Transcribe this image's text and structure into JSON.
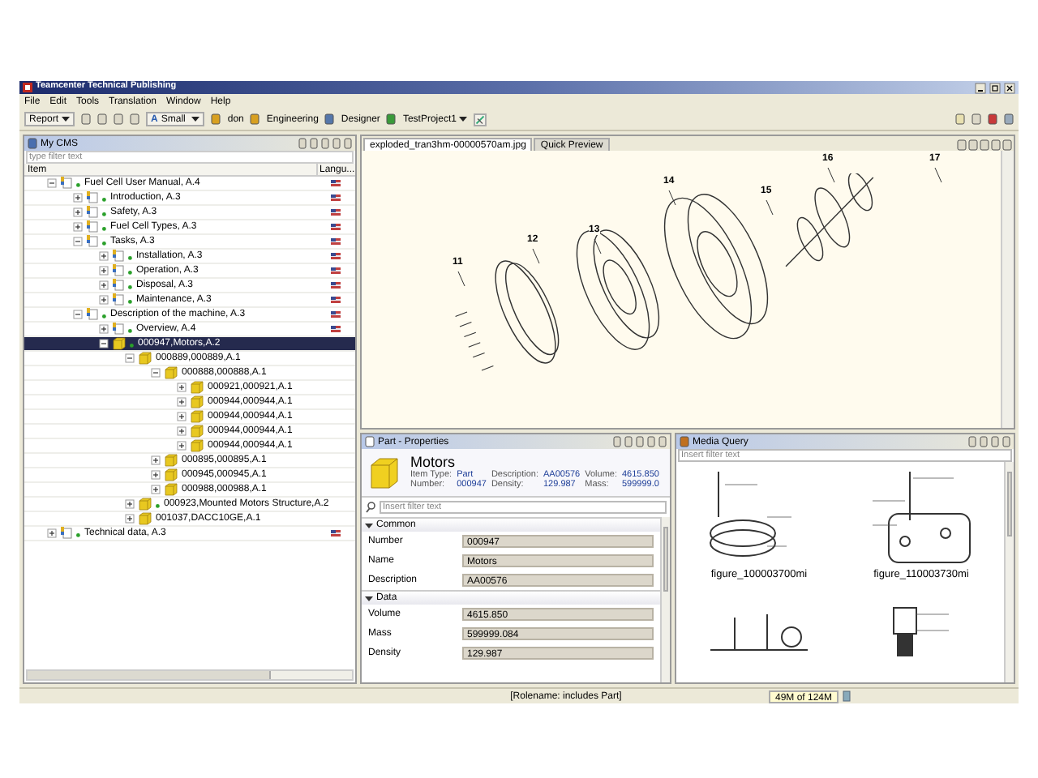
{
  "window": {
    "title": "Teamcenter Technical Publishing"
  },
  "menu": [
    "File",
    "Edit",
    "Tools",
    "Translation",
    "Window",
    "Help"
  ],
  "toolbar": {
    "report": "Report",
    "size_icon": "A",
    "size": "Small",
    "user": "don",
    "group": "Engineering",
    "role": "Designer",
    "project": "TestProject1"
  },
  "cms": {
    "tab": "My CMS",
    "filter_placeholder": "type filter text",
    "columns": [
      "Item",
      "Langu..."
    ],
    "tree": [
      {
        "label": "Fuel Cell User Manual, A.4",
        "kind": "document",
        "expanded": true,
        "selected": false,
        "released": true,
        "children": [
          {
            "label": "Introduction, A.3",
            "kind": "document",
            "expanded": false,
            "selected": false,
            "released": true
          },
          {
            "label": "Safety, A.3",
            "kind": "document",
            "expanded": false,
            "selected": false,
            "released": true
          },
          {
            "label": "Fuel Cell Types, A.3",
            "kind": "document",
            "expanded": false,
            "selected": false,
            "released": true
          },
          {
            "label": "Tasks, A.3",
            "kind": "document",
            "expanded": true,
            "selected": false,
            "released": true,
            "children": [
              {
                "label": "Installation, A.3",
                "kind": "document",
                "expanded": false,
                "selected": false,
                "released": true
              },
              {
                "label": "Operation, A.3",
                "kind": "document",
                "expanded": false,
                "selected": false,
                "released": true
              },
              {
                "label": "Disposal, A.3",
                "kind": "document",
                "expanded": false,
                "selected": false,
                "released": true
              },
              {
                "label": "Maintenance, A.3",
                "kind": "document",
                "expanded": false,
                "selected": false,
                "released": true
              }
            ]
          },
          {
            "label": "Description of the machine, A.3",
            "kind": "document",
            "expanded": true,
            "selected": false,
            "released": true,
            "children": [
              {
                "label": "Overview, A.4",
                "kind": "document",
                "expanded": false,
                "selected": false,
                "released": true
              },
              {
                "label": "000947,Motors,A.2",
                "kind": "part",
                "expanded": true,
                "selected": true,
                "released": true,
                "children": [
                  {
                    "label": "000889,000889,A.1",
                    "kind": "part",
                    "expanded": true,
                    "selected": false,
                    "released": false,
                    "children": [
                      {
                        "label": "000888,000888,A.1",
                        "kind": "part",
                        "expanded": true,
                        "selected": false,
                        "released": false,
                        "children": [
                          {
                            "label": "000921,000921,A.1",
                            "kind": "part",
                            "expanded": false,
                            "selected": false,
                            "released": false
                          },
                          {
                            "label": "000944,000944,A.1",
                            "kind": "part",
                            "expanded": false,
                            "selected": false,
                            "released": false
                          },
                          {
                            "label": "000944,000944,A.1",
                            "kind": "part",
                            "expanded": false,
                            "selected": false,
                            "released": false
                          },
                          {
                            "label": "000944,000944,A.1",
                            "kind": "part",
                            "expanded": false,
                            "selected": false,
                            "released": false
                          },
                          {
                            "label": "000944,000944,A.1",
                            "kind": "part",
                            "expanded": false,
                            "selected": false,
                            "released": false
                          }
                        ]
                      },
                      {
                        "label": "000895,000895,A.1",
                        "kind": "part",
                        "expanded": false,
                        "selected": false,
                        "released": false
                      },
                      {
                        "label": "000945,000945,A.1",
                        "kind": "part",
                        "expanded": false,
                        "selected": false,
                        "released": false
                      },
                      {
                        "label": "000988,000988,A.1",
                        "kind": "part",
                        "expanded": false,
                        "selected": false,
                        "released": false
                      }
                    ]
                  },
                  {
                    "label": "000923,Mounted Motors Structure,A.2",
                    "kind": "part",
                    "expanded": false,
                    "selected": false,
                    "released": true
                  },
                  {
                    "label": "001037,DACC10GE,A.1",
                    "kind": "part",
                    "expanded": false,
                    "selected": false,
                    "released": false
                  }
                ]
              }
            ]
          }
        ]
      },
      {
        "label": "Technical data, A.3",
        "kind": "document",
        "expanded": false,
        "selected": false,
        "released": true
      }
    ]
  },
  "editor": {
    "tabs": [
      {
        "label": "exploded_tran3hm-00000570am.jpg",
        "selected": true
      },
      {
        "label": "Quick Preview",
        "selected": false
      }
    ],
    "callouts": [
      "11",
      "12",
      "13",
      "14",
      "15",
      "16",
      "17"
    ]
  },
  "properties": {
    "tab": "Part - Properties",
    "name": "Motors",
    "summary": [
      {
        "label": "Item Type:",
        "value": "Part"
      },
      {
        "label": "Number:",
        "value": "000947"
      },
      {
        "label": "Description:",
        "value": "AA00576"
      },
      {
        "label": "Density:",
        "value": "129.987"
      },
      {
        "label": "Volume:",
        "value": "4615.850"
      },
      {
        "label": "Mass:",
        "value": "599999.0"
      }
    ],
    "filter_placeholder": "Insert filter text",
    "sections": [
      {
        "title": "Common",
        "expanded": true,
        "fields": [
          {
            "label": "Number",
            "value": "000947"
          },
          {
            "label": "Name",
            "value": "Motors"
          },
          {
            "label": "Description",
            "value": "AA00576"
          }
        ]
      },
      {
        "title": "Data",
        "expanded": true,
        "fields": [
          {
            "label": "Volume",
            "value": "4615.850"
          },
          {
            "label": "Mass",
            "value": "599999.084"
          },
          {
            "label": "Density",
            "value": "129.987"
          }
        ]
      }
    ]
  },
  "media": {
    "tab": "Media Query",
    "filter_placeholder": "Insert filter text",
    "figures": [
      "figure_100003700mi",
      "figure_110003730mi"
    ]
  },
  "status_bar": {
    "message": "[Rolename: includes Part]",
    "memory": "49M of 124M"
  }
}
